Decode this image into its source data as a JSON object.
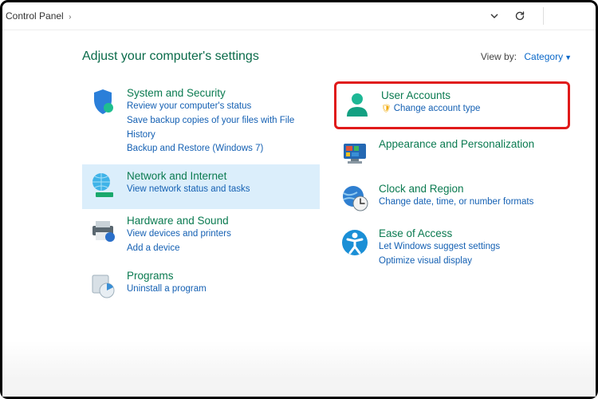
{
  "toolbar": {
    "breadcrumb": "Control Panel"
  },
  "page_title": "Adjust your computer's settings",
  "viewby": {
    "label": "View by:",
    "value": "Category"
  },
  "left": [
    {
      "title": "System and Security",
      "links": [
        "Review your computer's status",
        "Save backup copies of your files with File History",
        "Backup and Restore (Windows 7)"
      ]
    },
    {
      "title": "Network and Internet",
      "links": [
        "View network status and tasks"
      ]
    },
    {
      "title": "Hardware and Sound",
      "links": [
        "View devices and printers",
        "Add a device"
      ]
    },
    {
      "title": "Programs",
      "links": [
        "Uninstall a program"
      ]
    }
  ],
  "right": [
    {
      "title": "User Accounts",
      "links": [
        "Change account type"
      ],
      "shield_on": [
        0
      ],
      "highlight": true
    },
    {
      "title": "Appearance and Personalization",
      "links": []
    },
    {
      "title": "Clock and Region",
      "links": [
        "Change date, time, or number formats"
      ]
    },
    {
      "title": "Ease of Access",
      "links": [
        "Let Windows suggest settings",
        "Optimize visual display"
      ]
    }
  ]
}
